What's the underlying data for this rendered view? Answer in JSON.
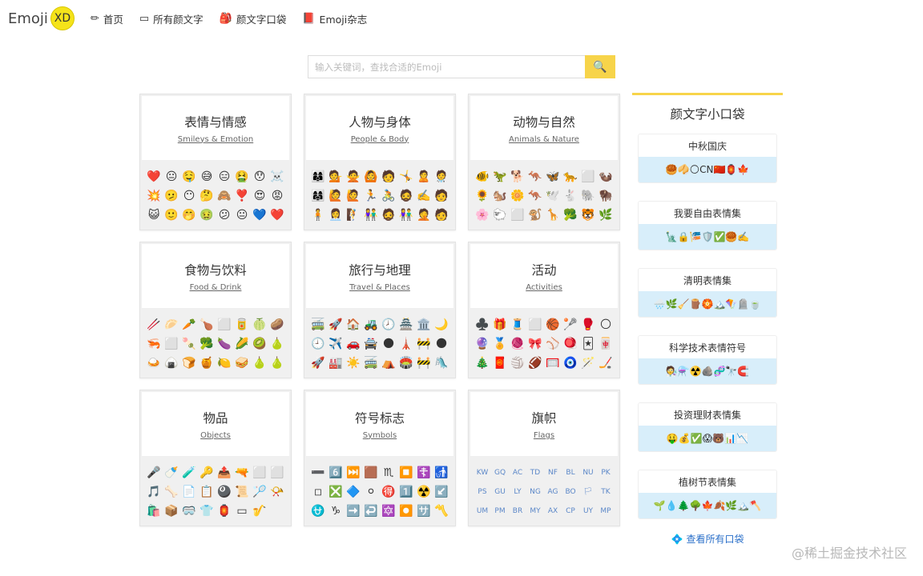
{
  "header": {
    "logo_text": "Emoji",
    "logo_badge": "XD",
    "nav": [
      {
        "icon": "✏",
        "label": "首页"
      },
      {
        "icon": "▭",
        "label": "所有颜文字"
      },
      {
        "icon": "🎒",
        "label": "颜文字口袋"
      },
      {
        "icon": "📕",
        "label": "Emoji杂志"
      }
    ]
  },
  "search": {
    "placeholder": "输入关键词，查找合适的Emoji",
    "button_icon": "🔍"
  },
  "categories": [
    {
      "zh": "表情与情感",
      "en": "Smileys & Emotion",
      "icons": [
        "❤️",
        "😐",
        "🤤",
        "😅",
        "😑",
        "🤮",
        "😯",
        "☠️",
        "💥",
        "🫤",
        "😶",
        "🤔",
        "🙈",
        "❣️",
        "😍",
        "😡",
        "😺",
        "🙂",
        "🤭",
        "🤢",
        "😕",
        "😐",
        "💙",
        "❤️"
      ]
    },
    {
      "zh": "人物与身体",
      "en": "People & Body",
      "icons": [
        "👩‍👩‍👦",
        "💁",
        "🙅",
        "🙆",
        "🧑",
        "🤸",
        "🙎",
        "🧑‍⚕️",
        "👩‍👩‍👧",
        "🙋",
        "🙋",
        "🏃",
        "🚴",
        "🧔",
        "✍️",
        "🧑",
        "🧍",
        "👩‍💼",
        "🧗",
        "👫",
        "🧔",
        "👫",
        "🤦",
        "🧑"
      ]
    },
    {
      "zh": "动物与自然",
      "en": "Animals & Nature",
      "icons": [
        "🐠",
        "🦖",
        "🐕",
        "🦘",
        "🦋",
        "🐆",
        "⬜",
        "🦦",
        "🌻",
        "🐿️",
        "🌼",
        "🦘",
        "🕊️",
        "🐇",
        "🐘",
        "🦬",
        "🌸",
        "🐑",
        "⬜",
        "🐒",
        "🦒",
        "🥦",
        "🐯",
        "🌿"
      ]
    },
    {
      "zh": "食物与饮料",
      "en": "Food & Drink",
      "icons": [
        "🥢",
        "🥟",
        "🥕",
        "🍗",
        "⬜",
        "🥫",
        "🍈",
        "🥔",
        "🦐",
        "⬜",
        "🍡",
        "🥦",
        "🍆",
        "🌽",
        "🥝",
        "🍐",
        "🍛",
        "🍙",
        "🍞",
        "🍯",
        "🍋",
        "🥪",
        "🍐",
        "🍐"
      ]
    },
    {
      "zh": "旅行与地理",
      "en": "Travel & Places",
      "icons": [
        "🚎",
        "🚀",
        "🏠",
        "🚜",
        "🕗",
        "🏯",
        "🏛️",
        "🌙",
        "🕘",
        "✈️",
        "🚗",
        "🚔",
        "🌑",
        "🗼",
        "🚧",
        "🌑",
        "🚀",
        "🏭",
        "☀️",
        "🚎",
        "⛺",
        "🏟️",
        "🚧",
        "🛝"
      ]
    },
    {
      "zh": "活动",
      "en": "Activities",
      "icons": [
        "♣️",
        "🎁",
        "🧵",
        "⬜",
        "🏀",
        "🥍",
        "🥊",
        "🌕",
        "🔮",
        "🏅",
        "🧶",
        "🎀",
        "⚾",
        "🪀",
        "🃏",
        "🀄",
        "🎄",
        "🧧",
        "🏐",
        "🏈",
        "🥅",
        "🧿",
        "🪄",
        "🏒"
      ]
    },
    {
      "zh": "物品",
      "en": "Objects",
      "icons": [
        "🎤",
        "🍼",
        "🧪",
        "🔑",
        "📤",
        "🔫",
        "⬜",
        "⬜",
        "🎵",
        "🦴",
        "📄",
        "📋",
        "🎱",
        "📜",
        "🏸",
        "📯",
        "🛍️",
        "📦",
        "🥽",
        "👕",
        "🏮",
        "▭",
        "🎷"
      ]
    },
    {
      "zh": "符号标志",
      "en": "Symbols",
      "icons": [
        "➖",
        "6️⃣",
        "⏭️",
        "🟫",
        "♏",
        "⏹️",
        "☦️",
        "🚮",
        "◽",
        "❎",
        "🔷",
        "⚪",
        "🉐",
        "1️⃣",
        "☢️",
        "↙️",
        "⛎",
        "♑",
        "➡️",
        "↩️",
        "🔯",
        "⏺️",
        "🈂️",
        "〽️"
      ]
    },
    {
      "zh": "旗帜",
      "en": "Flags",
      "flag": true,
      "icons": [
        "KW",
        "GQ",
        "AC",
        "TD",
        "NF",
        "BL",
        "NU",
        "PK",
        "PS",
        "GU",
        "LY",
        "NG",
        "AG",
        "BO",
        "🏳",
        "TK",
        "UM",
        "PM",
        "BR",
        "MY",
        "AX",
        "CP",
        "UY",
        "MP"
      ]
    }
  ],
  "sidebar": {
    "title": "颜文字小口袋",
    "pockets": [
      {
        "title": "中秋国庆",
        "emojis": "🥮🥠🌕CN🇨🇳🏮🍁"
      },
      {
        "title": "我要自由表情集",
        "emojis": "🗽🔒🎏🛡️✅🥮✍️"
      },
      {
        "title": "清明表情集",
        "emojis": "🌧️🌿🧹🪵🏵️🏔️🪁🪦🍵"
      },
      {
        "title": "科学技术表情符号",
        "emojis": "🧑‍🔬⚗️☢️🪨🧬🔭🧲"
      },
      {
        "title": "投资理财表情集",
        "emojis": "🤑💰✅😱🐻📊📉"
      },
      {
        "title": "植树节表情集",
        "emojis": "🌱💧🌲🌳🍁🍂🌿🏔️🪓"
      }
    ],
    "view_all": "查看所有口袋",
    "view_all_icon": "💠"
  },
  "watermark": "@稀土掘金技术社区"
}
